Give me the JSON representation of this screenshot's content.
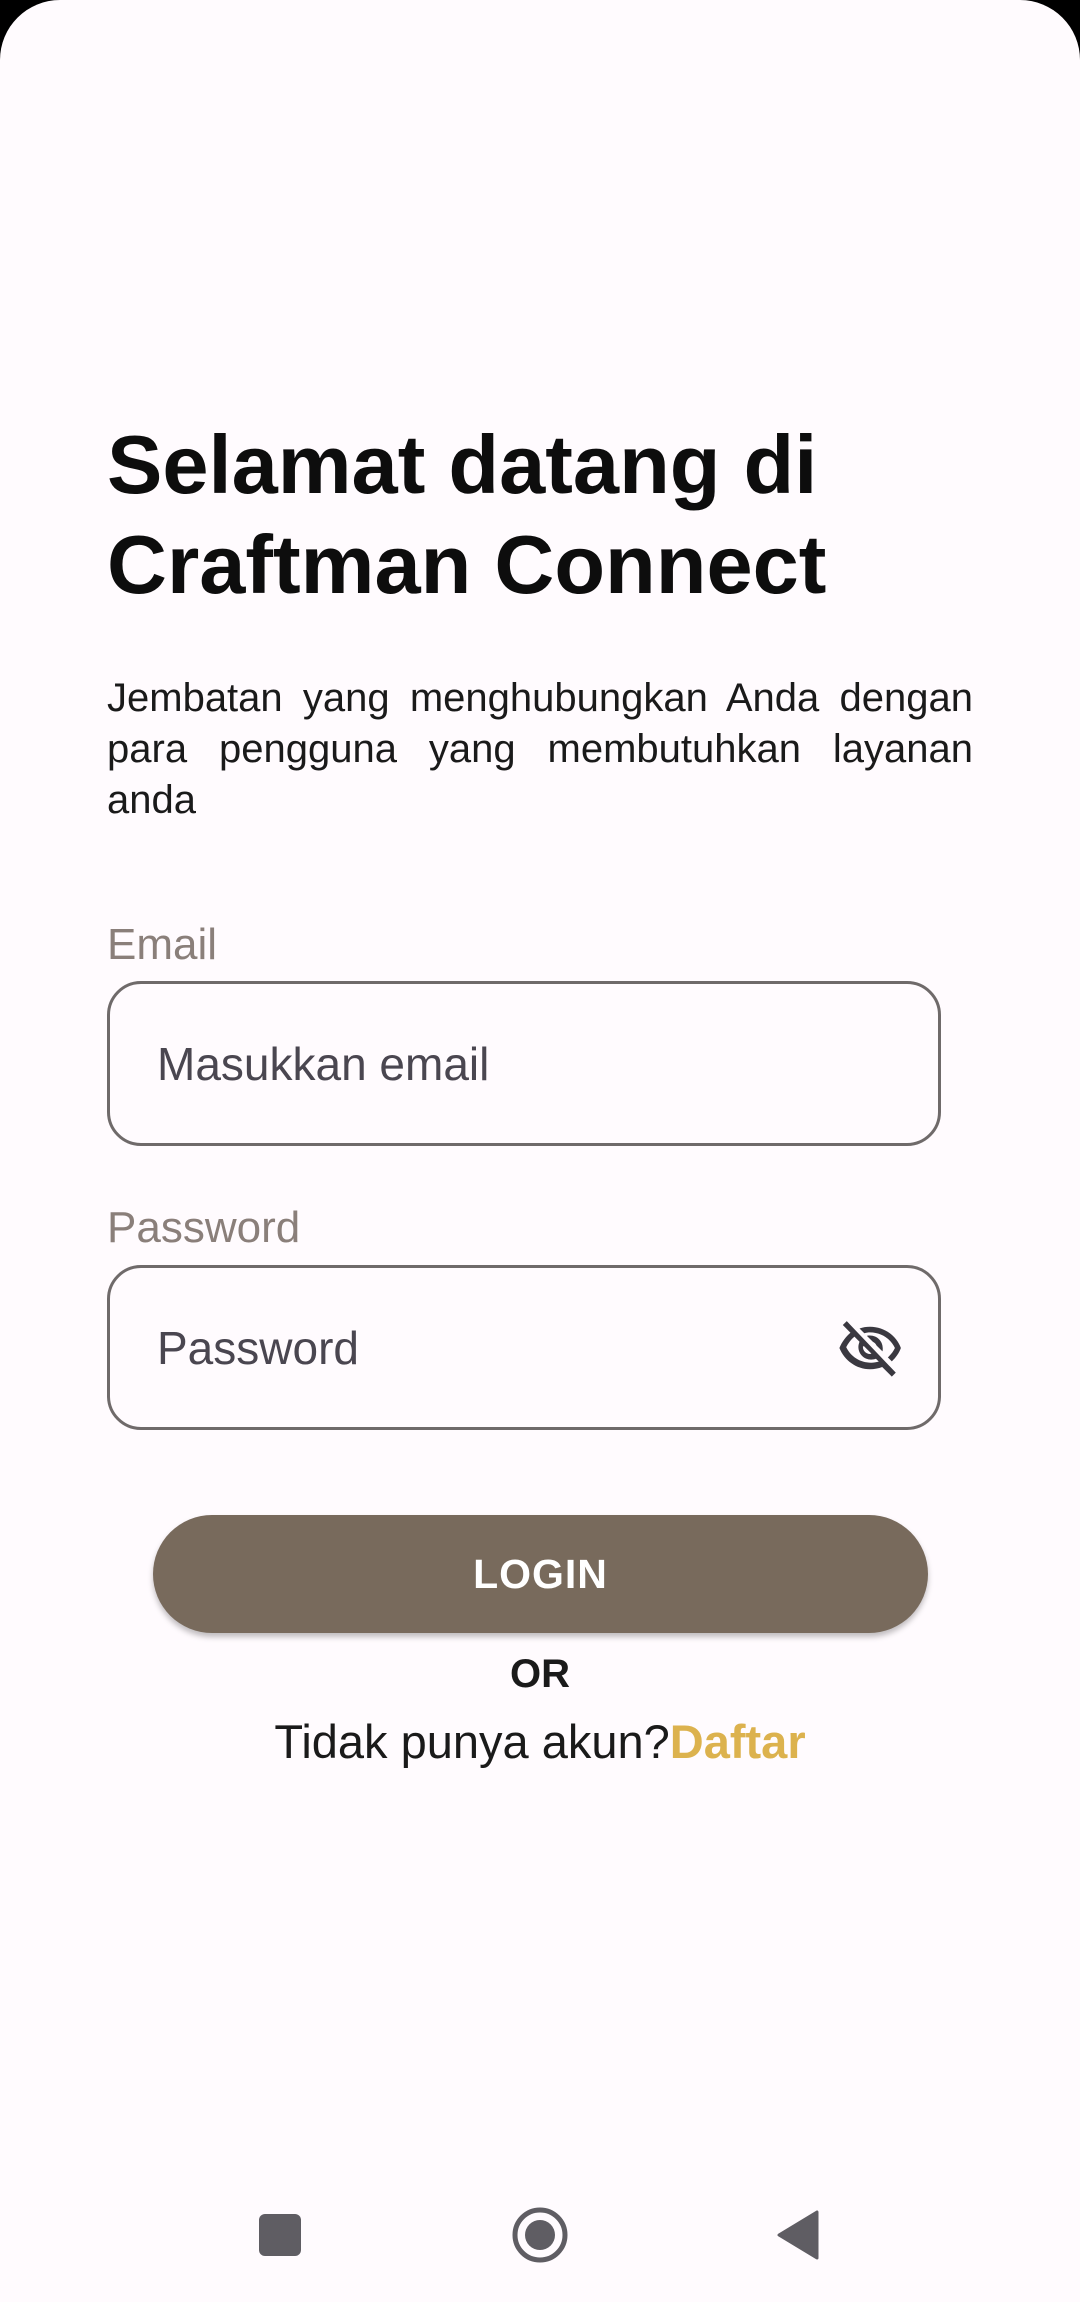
{
  "header": {
    "title_line1": "Selamat datang di",
    "title_line2": "Craftman Connect",
    "subtitle": "Jembatan yang menghubungkan Anda dengan para pengguna yang membutuhkan layanan anda"
  },
  "form": {
    "email_label": "Email",
    "email_placeholder": "Masukkan email",
    "password_label": "Password",
    "password_placeholder": "Password",
    "password_toggle_icon": "eye-off-icon",
    "login_label": "LOGIN",
    "or_label": "OR",
    "register_prompt": "Tidak punya akun?",
    "register_link": "Daftar"
  },
  "navbar": {
    "recents_icon": "recents-square-icon",
    "home_icon": "home-circle-icon",
    "back_icon": "back-triangle-icon"
  },
  "colors": {
    "background": "#fffbfe",
    "primary_button": "#786a5c",
    "link": "#dcb24e",
    "label": "#8a7f7a"
  }
}
